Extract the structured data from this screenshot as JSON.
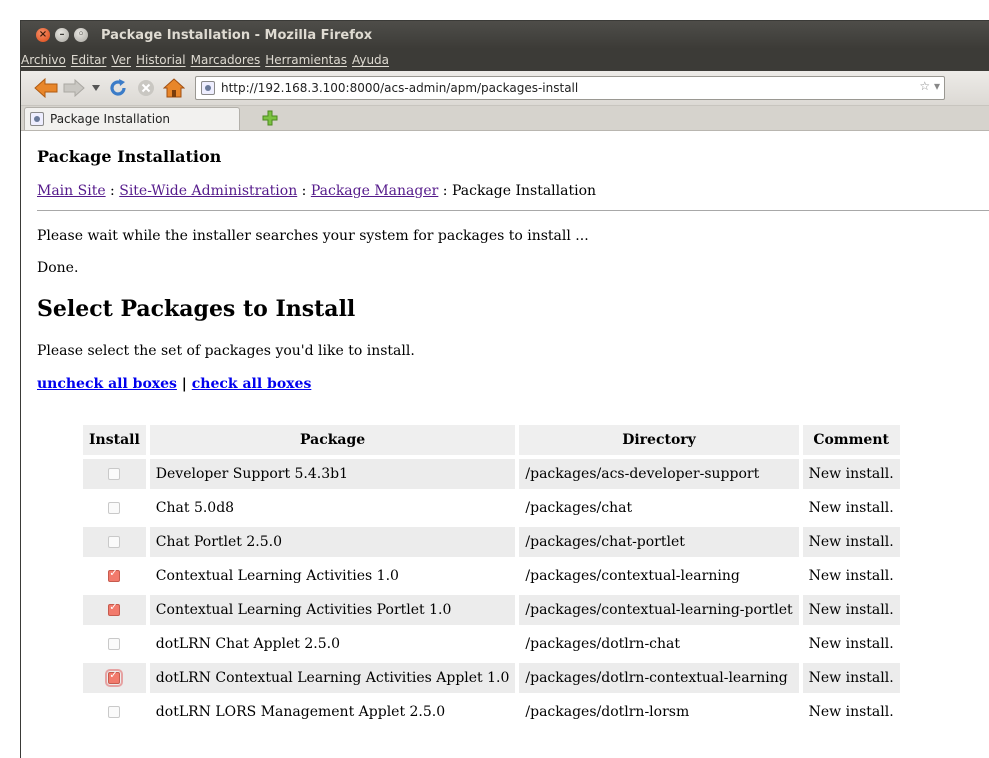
{
  "window": {
    "title": "Package Installation - Mozilla Firefox"
  },
  "menu": [
    "Archivo",
    "Editar",
    "Ver",
    "Historial",
    "Marcadores",
    "Herramientas",
    "Ayuda"
  ],
  "navbar": {
    "url": "http://192.168.3.100:8000/acs-admin/apm/packages-install"
  },
  "tab": {
    "title": "Package Installation"
  },
  "page": {
    "title": "Package Installation",
    "breadcrumb": {
      "main_site": "Main Site",
      "sep": " : ",
      "site_wide_admin": "Site-Wide Administration",
      "package_manager": "Package Manager",
      "current": "Package Installation"
    },
    "wait_text": "Please wait while the installer searches your system for packages to install ...",
    "done_text": "Done.",
    "heading": "Select Packages to Install",
    "instructions": "Please select the set of packages you'd like to install.",
    "uncheck_all": "uncheck all boxes",
    "toggle_sep": " | ",
    "check_all": "check all boxes"
  },
  "table": {
    "headers": [
      "Install",
      "Package",
      "Directory",
      "Comment"
    ],
    "rows": [
      {
        "checked": false,
        "package": "Developer Support 5.4.3b1",
        "directory": "/packages/acs-developer-support",
        "comment": "New install."
      },
      {
        "checked": false,
        "package": "Chat 5.0d8",
        "directory": "/packages/chat",
        "comment": "New install."
      },
      {
        "checked": false,
        "package": "Chat Portlet 2.5.0",
        "directory": "/packages/chat-portlet",
        "comment": "New install."
      },
      {
        "checked": true,
        "package": "Contextual Learning Activities 1.0",
        "directory": "/packages/contextual-learning",
        "comment": "New install."
      },
      {
        "checked": true,
        "package": "Contextual Learning Activities Portlet 1.0",
        "directory": "/packages/contextual-learning-portlet",
        "comment": "New install."
      },
      {
        "checked": false,
        "package": "dotLRN Chat Applet 2.5.0",
        "directory": "/packages/dotlrn-chat",
        "comment": "New install."
      },
      {
        "checked": true,
        "focused": true,
        "package": "dotLRN Contextual Learning Activities Applet 1.0",
        "directory": "/packages/dotlrn-contextual-learning",
        "comment": "New install."
      },
      {
        "checked": false,
        "package": "dotLRN LORS Management Applet 2.5.0",
        "directory": "/packages/dotlrn-lorsm",
        "comment": "New install."
      }
    ]
  }
}
